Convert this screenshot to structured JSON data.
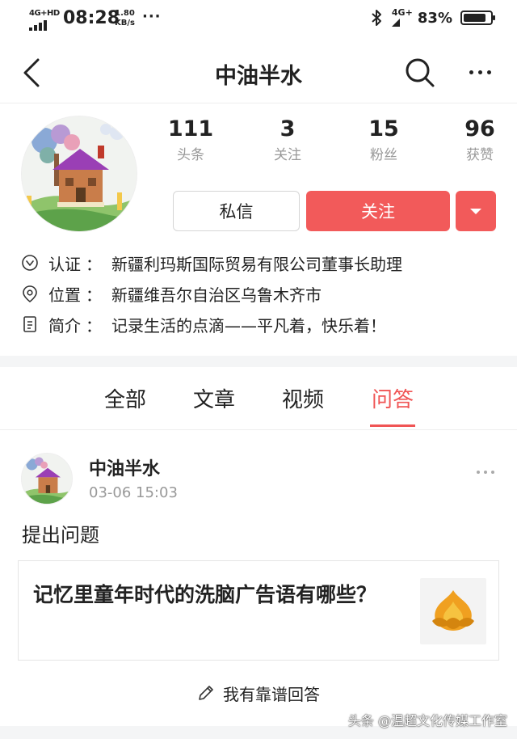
{
  "status_bar": {
    "network": "4G+HD",
    "time": "08:28",
    "speed_value": "1.80",
    "speed_unit": "KB/s",
    "network_right": "4G+",
    "battery_percent": "83%",
    "battery_level": 0.83
  },
  "header": {
    "title": "中油半水",
    "back_icon": "back-arrow-icon",
    "search_icon": "search-icon",
    "more_icon": "more-dots-icon"
  },
  "profile": {
    "stats": [
      {
        "value": "111",
        "label": "头条"
      },
      {
        "value": "3",
        "label": "关注"
      },
      {
        "value": "15",
        "label": "粉丝"
      },
      {
        "value": "96",
        "label": "获赞"
      }
    ],
    "message_button": "私信",
    "follow_button": "关注",
    "info": {
      "verify_label": "认证",
      "verify_value": "新疆利玛斯国际贸易有限公司董事长助理",
      "location_label": "位置",
      "location_value": "新疆维吾尔自治区乌鲁木齐市",
      "bio_label": "简介",
      "bio_value": "记录生活的点滴——平凡着，快乐着！",
      "separator": "："
    }
  },
  "tabs": [
    {
      "label": "全部",
      "active": false
    },
    {
      "label": "文章",
      "active": false
    },
    {
      "label": "视频",
      "active": false
    },
    {
      "label": "问答",
      "active": true
    }
  ],
  "feed": {
    "author": "中油半水",
    "time": "03-06 15:03",
    "action": "提出问题",
    "question_title": "记忆里童年时代的洗脑广告语有哪些？",
    "answer_link": "我有靠谱回答"
  },
  "watermark": "头条 @温超文化传媒工作室",
  "colors": {
    "accent": "#f25a5a",
    "tab_active": "#f05555",
    "muted_text": "#999999"
  }
}
